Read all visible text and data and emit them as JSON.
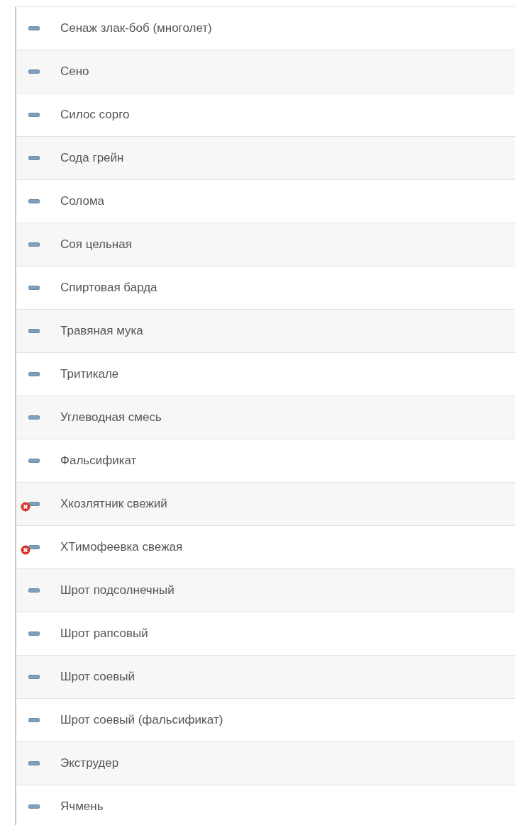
{
  "items": [
    {
      "label": "Сенаж злак-боб (многолет)",
      "error": false
    },
    {
      "label": "Сено",
      "error": false
    },
    {
      "label": "Силос сорго",
      "error": false
    },
    {
      "label": "Сода грейн",
      "error": false
    },
    {
      "label": "Солома",
      "error": false
    },
    {
      "label": "Соя цельная",
      "error": false
    },
    {
      "label": "Спиртовая барда",
      "error": false
    },
    {
      "label": "Травяная мука",
      "error": false
    },
    {
      "label": "Тритикале",
      "error": false
    },
    {
      "label": "Углеводная смесь",
      "error": false
    },
    {
      "label": "Фальсификат",
      "error": false
    },
    {
      "label": "Хкозлятник свежий",
      "error": true
    },
    {
      "label": "ХТимофеевка свежая",
      "error": true
    },
    {
      "label": "Шрот подсолнечный",
      "error": false
    },
    {
      "label": "Шрот рапсовый",
      "error": false
    },
    {
      "label": "Шрот соевый",
      "error": false
    },
    {
      "label": "Шрот соевый (фальсификат)",
      "error": false
    },
    {
      "label": "Экструдер",
      "error": false
    },
    {
      "label": "Ячмень",
      "error": false
    }
  ]
}
